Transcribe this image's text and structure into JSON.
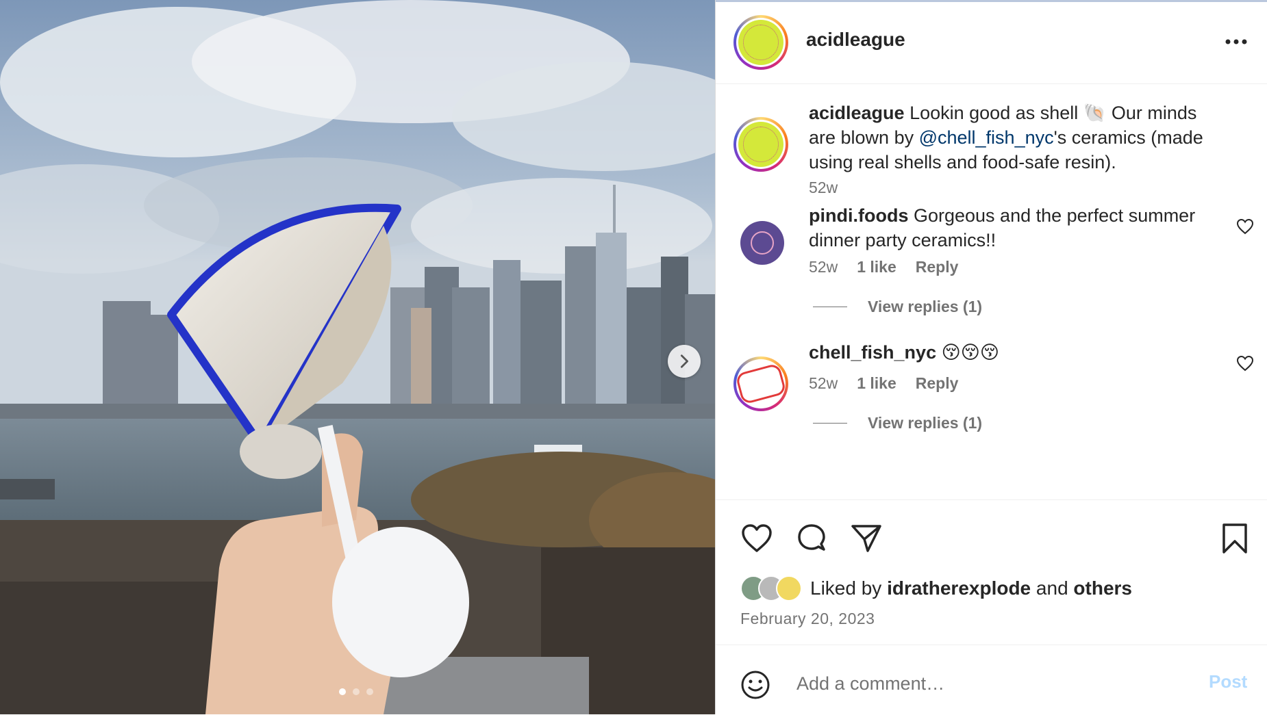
{
  "post": {
    "username": "acidleague",
    "caption": {
      "user": "acidleague",
      "text_before_mention": "Lookin good as shell 🐚 Our minds are blown by ",
      "mention": "@chell_fish_nyc",
      "text_after_mention": "'s ceramics (made using real shells and food-safe resin).",
      "age": "52w"
    },
    "comments": [
      {
        "user": "pindi.foods",
        "text": "Gorgeous and the perfect summer dinner party ceramics!!",
        "age": "52w",
        "likes": "1 like",
        "reply": "Reply",
        "view_replies": "View replies (1)"
      },
      {
        "user": "chell_fish_nyc",
        "text": "😚😚😚",
        "age": "52w",
        "likes": "1 like",
        "reply": "Reply",
        "view_replies": "View replies (1)"
      }
    ],
    "liked_by_prefix": "Liked by",
    "liked_by_user": "idratherexplode",
    "liked_by_and": "and",
    "liked_by_others": "others",
    "date": "February 20, 2023",
    "comment_placeholder": "Add a comment…",
    "post_label": "Post",
    "carousel": {
      "count": 3,
      "active_index": 0
    },
    "colors": {
      "accent_blue": "#0095f6",
      "mention": "#00376b",
      "post_disabled": "#b3dbff"
    },
    "icons": [
      "more-options-icon",
      "heart-icon",
      "comment-icon",
      "share-icon",
      "bookmark-icon",
      "emoji-icon",
      "chevron-right-icon"
    ]
  }
}
